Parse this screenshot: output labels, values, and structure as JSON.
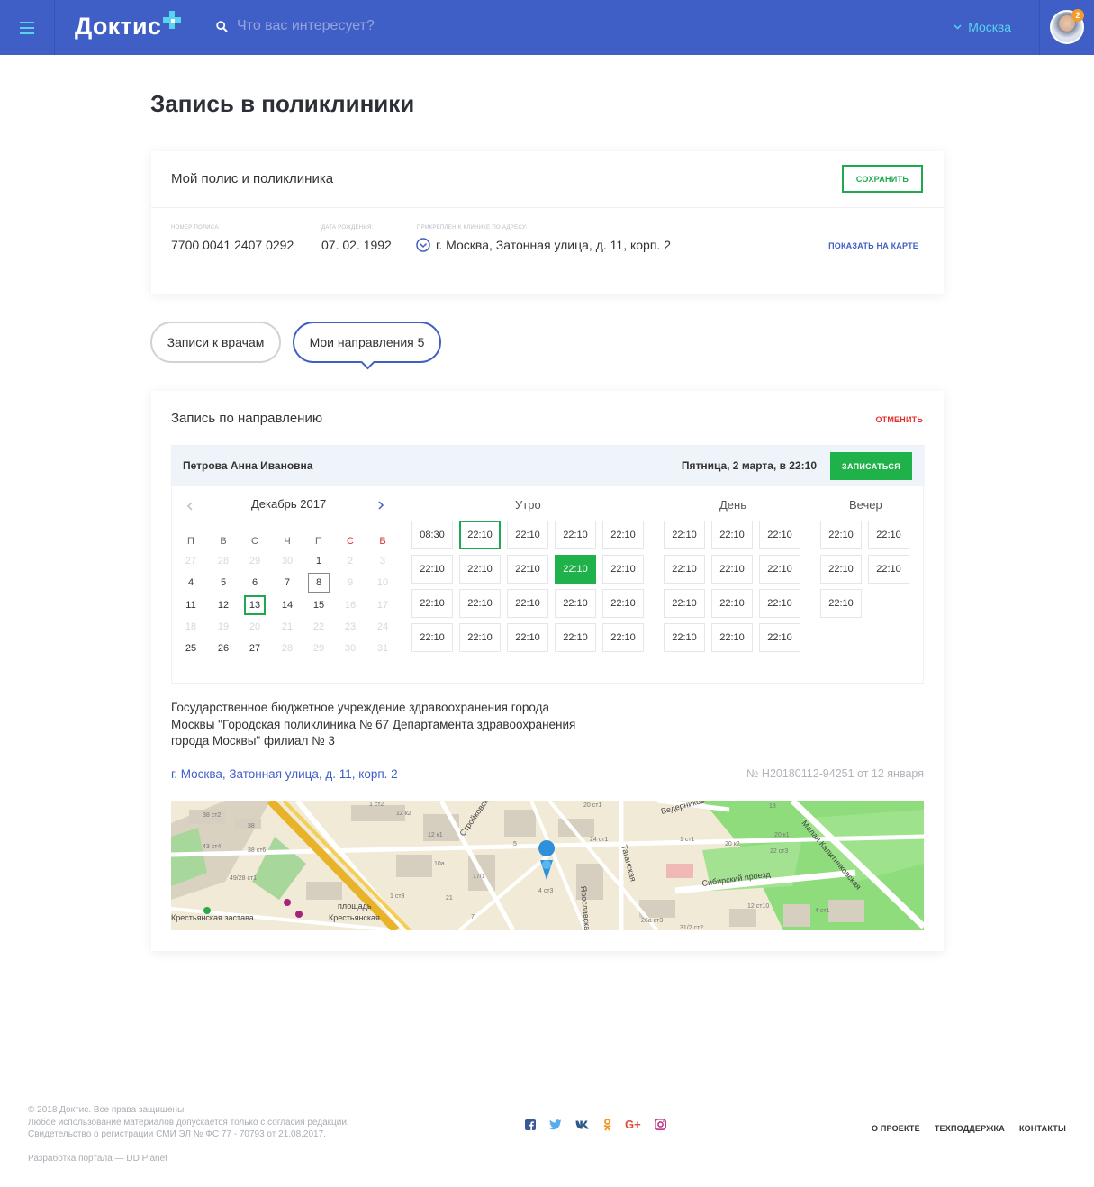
{
  "header": {
    "logo": "Доктис",
    "search_placeholder": "Что вас интересует?",
    "city": "Москва",
    "notifications": "2",
    "colors": {
      "bg": "#3f5ec6",
      "accent": "#58d4ee"
    }
  },
  "page_title": "Запись в поликлиники",
  "policy": {
    "title": "Мой полис и поликлиника",
    "save_label": "СОХРАНИТЬ",
    "fields": [
      {
        "label": "НОМЕР ПОЛИСА:",
        "value": "7700 0041 2407 0292"
      },
      {
        "label": "ДАТА РОЖДЕНИЯ:",
        "value": "07. 02. 1992"
      },
      {
        "label": "ПРИКРЕПЛЕН К КЛИНИКЕ ПО АДРЕСУ:",
        "value": "г. Москва, Затонная улица, д. 11, корп. 2"
      }
    ],
    "map_link": "ПОКАЗАТЬ НА КАРТЕ"
  },
  "tabs": [
    {
      "label": "Записи к врачам"
    },
    {
      "label": "Мои направления 5"
    }
  ],
  "referral": {
    "title": "Запись по направлению",
    "cancel_label": "ОТМЕНИТЬ",
    "patient": "Петрова Анна Ивановна",
    "datetime": "Пятница, 2 марта, в 22:10",
    "book_label": "ЗАПИСАТЬСЯ",
    "calendar": {
      "month": "Декабрь 2017",
      "weekdays": [
        "П",
        "В",
        "С",
        "Ч",
        "П",
        "С",
        "В"
      ],
      "weeks": [
        [
          "27",
          "28",
          "29",
          "30",
          "1",
          "2",
          "3"
        ],
        [
          "4",
          "5",
          "6",
          "7",
          "8",
          "9",
          "10"
        ],
        [
          "11",
          "12",
          "13",
          "14",
          "15",
          "16",
          "17"
        ],
        [
          "18",
          "19",
          "20",
          "21",
          "22",
          "23",
          "24"
        ],
        [
          "25",
          "26",
          "27",
          "28",
          "29",
          "30",
          "31"
        ]
      ]
    },
    "slot_groups": [
      {
        "title": "Утро",
        "rows": [
          [
            "08:30",
            "22:10",
            "22:10",
            "22:10",
            "22:10"
          ],
          [
            "22:10",
            "22:10",
            "22:10",
            "22:10",
            "22:10"
          ],
          [
            "22:10",
            "22:10",
            "22:10",
            "22:10",
            "22:10"
          ],
          [
            "22:10",
            "22:10",
            "22:10",
            "22:10",
            "22:10"
          ]
        ]
      },
      {
        "title": "День",
        "rows": [
          [
            "22:10",
            "22:10",
            "22:10"
          ],
          [
            "22:10",
            "22:10",
            "22:10"
          ],
          [
            "22:10",
            "22:10",
            "22:10"
          ],
          [
            "22:10",
            "22:10",
            "22:10"
          ]
        ]
      },
      {
        "title": "Вечер",
        "rows": [
          [
            "22:10",
            "22:10"
          ],
          [
            "22:10",
            "22:10"
          ],
          [
            "22:10"
          ]
        ]
      }
    ],
    "clinic_name": "Государственное бюджетное учреждение здравоохранения города Москвы \"Городская поликлиника № 67 Департамента здравоохранения города Москвы\" филиал № 3",
    "clinic_address": "г. Москва, Затонная улица, д. 11, корп. 2",
    "referral_number": "№ Н20180112-94251 от 12 января",
    "map_labels": [
      "Стройковская",
      "Таганская",
      "Ведерников",
      "Сибирский проезд",
      "Малая Калитниковская",
      "Ярославская",
      "площадь",
      "Крестьянская",
      "Крестьянская застава",
      "38 ст2",
      "38",
      "43 ст4",
      "38 ст6",
      "49/28 ст1",
      "12 к2",
      "12 к1",
      "10а",
      "17/1",
      "21",
      "7",
      "4 ст3",
      "24 ст1",
      "20 ст1",
      "1 ст1",
      "20 к2",
      "22 ст3",
      "20 к1",
      "18",
      "12 ст10",
      "4 ст1",
      "1 ст2",
      "26а ст3",
      "31/2 ст2",
      "1 ст3",
      "5"
    ]
  },
  "footer": {
    "copyright_lines": [
      "© 2018 Доктис. Все права защищены.",
      "Любое использование материалов допускается только с согласия редакции.",
      "Свидетельство о регистрации СМИ ЭЛ № ФС 77 - 70793 от 21.08.2017."
    ],
    "developer": "Разработка портала — DD Planet",
    "social": [
      "facebook-icon",
      "twitter-icon",
      "vk-icon",
      "ok-icon",
      "google-plus-icon",
      "instagram-icon"
    ],
    "links": [
      "О ПРОЕКТЕ",
      "ТЕХПОДДЕРЖКА",
      "КОНТАКТЫ"
    ]
  }
}
